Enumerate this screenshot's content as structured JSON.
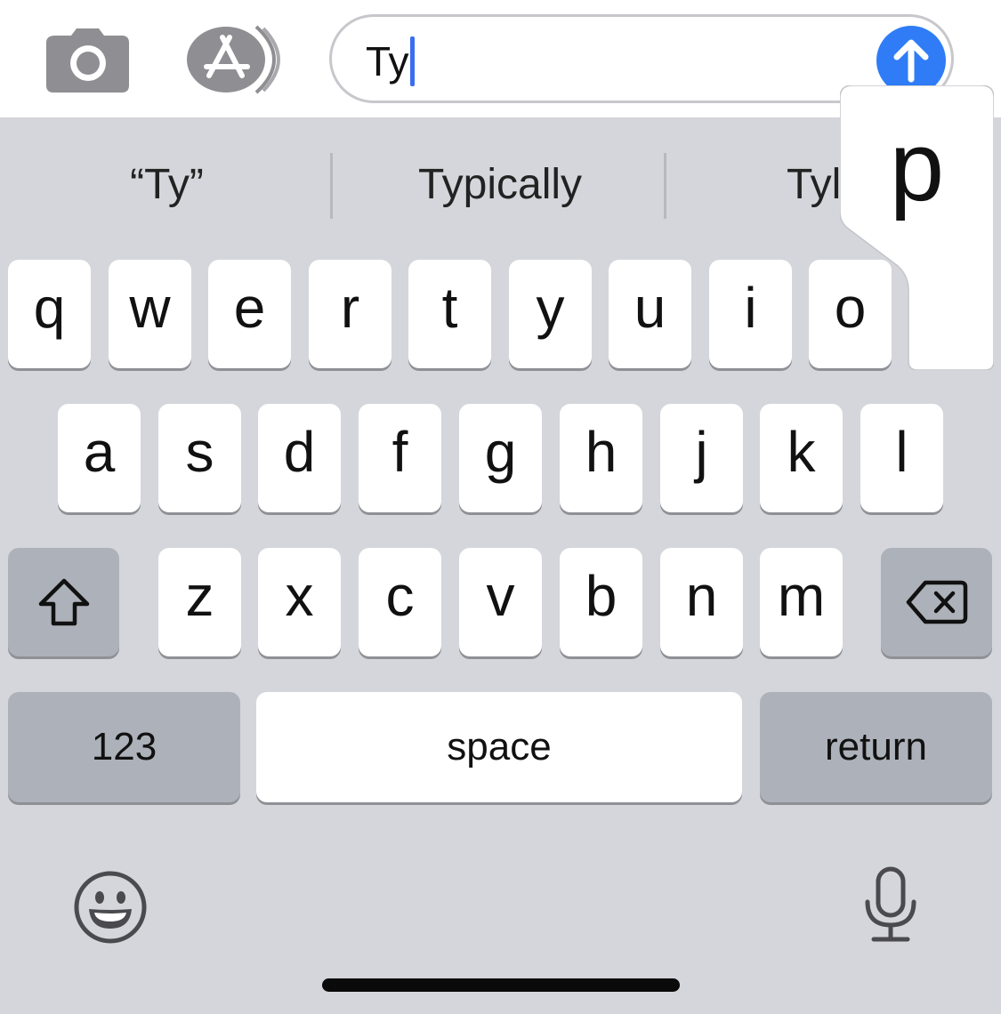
{
  "compose": {
    "text": "Ty",
    "camera_icon": "camera-icon",
    "apps_icon": "app-store-icon",
    "send_icon": "arrow-up-icon"
  },
  "suggestions": [
    "“Ty”",
    "Typically",
    "Tyl"
  ],
  "keys": {
    "row1": [
      "q",
      "w",
      "e",
      "r",
      "t",
      "y",
      "u",
      "i",
      "o",
      "p"
    ],
    "row2": [
      "a",
      "s",
      "d",
      "f",
      "g",
      "h",
      "j",
      "k",
      "l"
    ],
    "row3": [
      "z",
      "x",
      "c",
      "v",
      "b",
      "n",
      "m"
    ],
    "numbers_label": "123",
    "space_label": "space",
    "return_label": "return",
    "shift_icon": "shift-icon",
    "delete_icon": "delete-icon",
    "emoji_icon": "emoji-icon",
    "mic_icon": "microphone-icon"
  },
  "popup": {
    "char": "p"
  },
  "colors": {
    "accent": "#2f7cf6",
    "keyboard_bg": "#d5d6db",
    "key_bg": "#ffffff",
    "fn_key_bg": "#adb1b9"
  }
}
